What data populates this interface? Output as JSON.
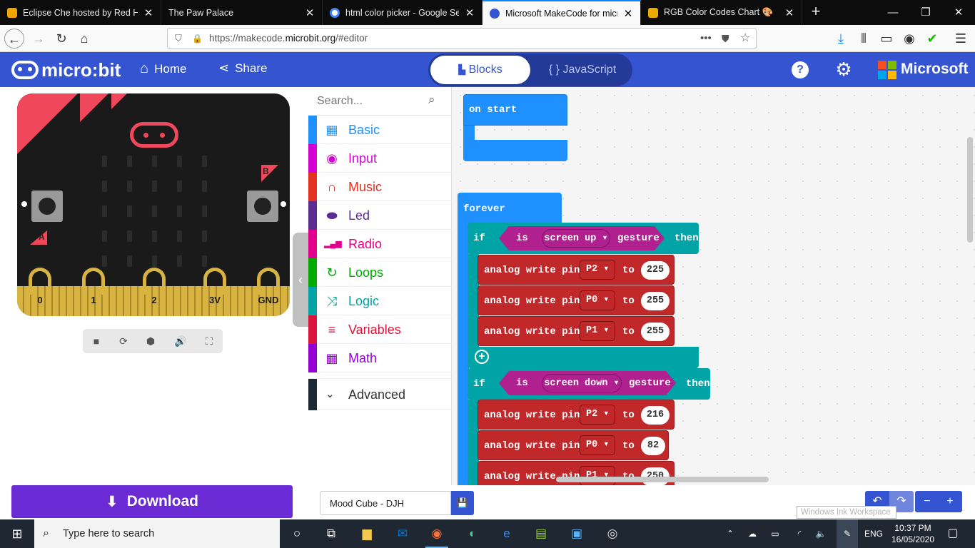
{
  "browser": {
    "tabs": [
      {
        "title": "Eclipse Che hosted by Red Hat",
        "favicon_color": "#f0a500",
        "active": false
      },
      {
        "title": "The Paw Palace",
        "favicon_color": "#0c0c0d",
        "active": false
      },
      {
        "title": "html color picker - Google Sear",
        "favicon_color": "#4285f4",
        "active": false
      },
      {
        "title": "Microsoft MakeCode for micro",
        "favicon_color": "#3454d1",
        "active": true
      },
      {
        "title": "RGB Color Codes Chart 🎨",
        "favicon_color": "#e8a900",
        "active": false
      }
    ],
    "url_prefix": "https://makecode.",
    "url_domain": "microbit.org",
    "url_suffix": "/#editor",
    "colors": {
      "accent": "#0a84ff",
      "chrome": "#0c0c0d"
    }
  },
  "header": {
    "brand": "micro:bit",
    "home_label": "Home",
    "share_label": "Share",
    "blocks_label": "Blocks",
    "js_label": "JavaScript",
    "microsoft_label": "Microsoft",
    "color": "#3454d1"
  },
  "simulator": {
    "pins": [
      "0",
      "1",
      "2",
      "3V",
      "GND"
    ],
    "button_a": "A",
    "button_b": "B",
    "controls": [
      "stop-icon",
      "restart-icon",
      "debug-icon",
      "mute-icon",
      "fullscreen-icon"
    ]
  },
  "toolbox": {
    "search_placeholder": "Search...",
    "categories": [
      {
        "label": "Basic",
        "color": "#1e90ff",
        "icon": "grid-icon"
      },
      {
        "label": "Input",
        "color": "#d400d4",
        "icon": "target-icon"
      },
      {
        "label": "Music",
        "color": "#e63022",
        "icon": "headphones-icon"
      },
      {
        "label": "Led",
        "color": "#5c2d91",
        "icon": "toggle-icon"
      },
      {
        "label": "Radio",
        "color": "#e3008c",
        "icon": "signal-icon"
      },
      {
        "label": "Loops",
        "color": "#00aa00",
        "icon": "refresh-icon"
      },
      {
        "label": "Logic",
        "color": "#00a4a6",
        "icon": "shuffle-icon"
      },
      {
        "label": "Variables",
        "color": "#dc143c",
        "icon": "list-icon"
      },
      {
        "label": "Math",
        "color": "#9400d3",
        "icon": "calculator-icon"
      }
    ],
    "advanced_label": "Advanced"
  },
  "blocks": {
    "on_start": "on start",
    "forever": "forever",
    "if_kw": "if",
    "then_kw": "then",
    "is_kw": "is",
    "gesture_kw": "gesture",
    "to_kw": "to",
    "analog_label": "analog write pin",
    "gesture1": "screen up",
    "gesture2": "screen down",
    "group1": [
      {
        "pin": "P2",
        "value": "225"
      },
      {
        "pin": "P0",
        "value": "255"
      },
      {
        "pin": "P1",
        "value": "255"
      }
    ],
    "group2": [
      {
        "pin": "P2",
        "value": "216"
      },
      {
        "pin": "P0",
        "value": "82"
      },
      {
        "pin": "P1",
        "value": "250"
      }
    ]
  },
  "bottom": {
    "download_label": "Download",
    "project_name": "Mood Cube - DJH",
    "ink_label": "Windows Ink Workspace"
  },
  "taskbar": {
    "search_placeholder": "Type here to search",
    "language": "ENG",
    "time": "10:37 PM",
    "date": "16/05/2020"
  }
}
